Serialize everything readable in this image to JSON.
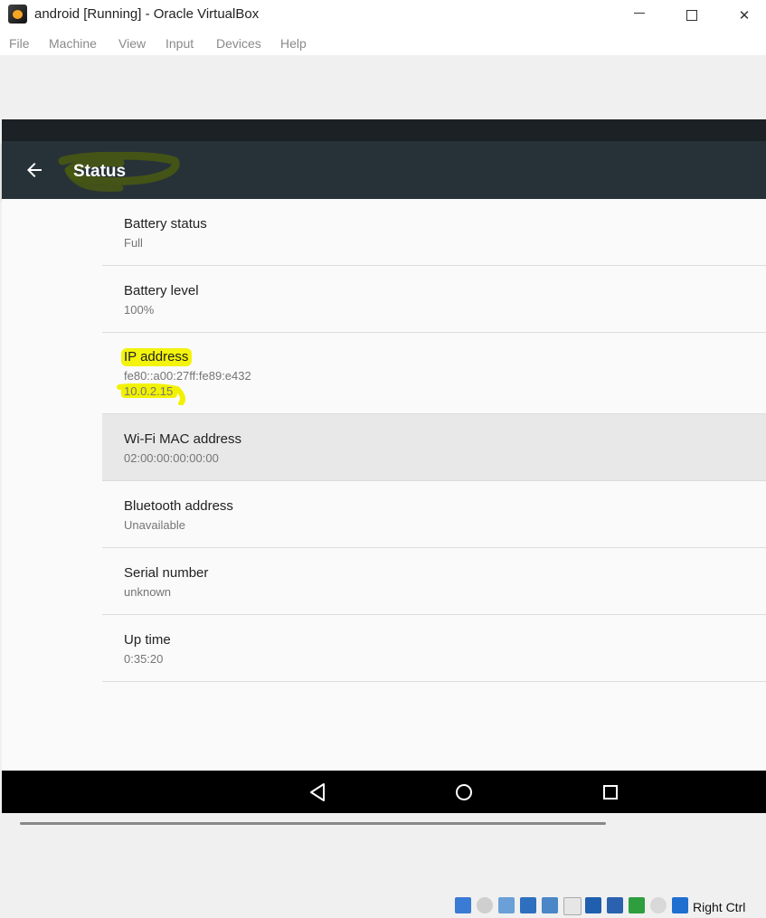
{
  "window": {
    "title": "android [Running] - Oracle VirtualBox",
    "controls": {
      "minimize": "minimize",
      "maximize": "maximize",
      "close": "✕"
    }
  },
  "menu": [
    "File",
    "Machine",
    "View",
    "Input",
    "Devices",
    "Help"
  ],
  "appbar": {
    "title": "Status"
  },
  "rows": [
    {
      "title": "Battery status",
      "value": "Full"
    },
    {
      "title": "Battery level",
      "value": "100%"
    },
    {
      "title": "IP address",
      "value": "fe80::a00:27ff:fe89:e432",
      "value2": "10.0.2.15"
    },
    {
      "title": "Wi-Fi MAC address",
      "value": "02:00:00:00:00:00",
      "selected": true
    },
    {
      "title": "Bluetooth address",
      "value": "Unavailable"
    },
    {
      "title": "Serial number",
      "value": "unknown"
    },
    {
      "title": "Up time",
      "value": "0:35:20"
    }
  ],
  "statusbar": {
    "host_key": "Right Ctrl"
  },
  "colors": {
    "appbar": "#273238",
    "statusbar": "#1b2125",
    "highlight": "#f2f200",
    "navbar": "#000000"
  }
}
